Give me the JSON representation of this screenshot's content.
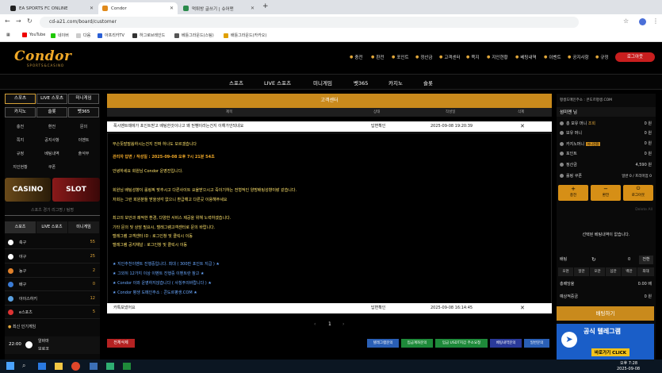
{
  "browser": {
    "tabs": [
      {
        "title": "EA SPORTS FC ONLINE",
        "active": false
      },
      {
        "title": "Condor",
        "active": true
      },
      {
        "title": "먹튀방 글쓰기 | 슈어맨",
        "active": false
      }
    ],
    "new_tab": "+",
    "url": "cd-a21.com/board/customer",
    "bookmarks": [
      "YouTube",
      "네이버",
      "다음",
      "아프리카TV",
      "하그로브레인드",
      "베틀그라운드(스팀)",
      "배틀그라운드(카카오)"
    ]
  },
  "site": {
    "logo": "Condor",
    "logo_sub": "SPORTS&CASINO",
    "top_nav": [
      "충전",
      "환전",
      "포인트",
      "정산금",
      "고객센터",
      "쪽지",
      "지인현황",
      "베팅내역",
      "이벤트",
      "공지사항",
      "규정"
    ],
    "logout": "로그아웃",
    "main_nav": [
      "스포츠",
      "LIVE 스포츠",
      "미니게임",
      "벳365",
      "카지노",
      "슬롯"
    ]
  },
  "left": {
    "grid": [
      [
        "스포츠",
        "LIVE 스포츠",
        "미니게임"
      ],
      [
        "카지노",
        "슬롯",
        "벳365"
      ]
    ],
    "menu": [
      [
        "충전",
        "환전",
        "문의"
      ],
      [
        "쪽지",
        "공지사항",
        "이벤트"
      ],
      [
        "규정",
        "베팅내역",
        "출석부"
      ],
      [
        "지인현황",
        "쿠폰",
        ""
      ]
    ],
    "banners": [
      "CASINO",
      "SLOT"
    ],
    "search_placeholder": "스포츠 경기 리그명 / 팀명",
    "sport_tabs": [
      "스포츠",
      "LIVE 스포츠",
      "미니게임"
    ],
    "sports": [
      {
        "name": "축구",
        "count": "55",
        "color": "#ffffff"
      },
      {
        "name": "야구",
        "count": "25",
        "color": "#ffffff"
      },
      {
        "name": "농구",
        "count": "2",
        "color": "#e0802a"
      },
      {
        "name": "배구",
        "count": "0",
        "color": "#3a7bd5"
      },
      {
        "name": "아이스하키",
        "count": "12",
        "color": "#5aa0e0"
      },
      {
        "name": "e스포츠",
        "count": "5",
        "color": "#d33"
      }
    ],
    "popular_title": "최신 인기게임",
    "match": {
      "time": "22:00",
      "team1": "알바마",
      "team2": "모로코"
    }
  },
  "center": {
    "title": "고객센터",
    "headers": [
      "제목",
      "상태",
      "작성일",
      "삭제"
    ],
    "rows": [
      {
        "title": "폭시벤트때에가 포인트받고 배팅한것이나고 왜 믿뺑이라는건지 이해가안되네요",
        "status": "답변확인",
        "date": "2025-09-08 19:20:39",
        "del": "✕"
      },
      {
        "title": "카톡보냈어요",
        "status": "답변확인",
        "date": "2025-09-08 16:14:45",
        "del": "✕"
      }
    ],
    "content": [
      {
        "text": "무슨뜻발말씀하시는건지 진짜 하나도 모르겠습니다",
        "color": "#ffe36b"
      },
      {
        "text": "관리자 답변 / 작성일 : 2025-09-08 오후 7시 21분 54초",
        "color": "#f0a928"
      },
      {
        "text": "안녕하세요 회원님 Condor 운영진입니다.",
        "color": "#ffe36b"
      },
      {
        "text": "회원님 배팅성향이 롤링픽 맞추시고 다른사이트 요율받으시고 죽이기하는 전형적인 양방배팅성향이랑 같습니다.",
        "color": "#ffe36b"
      },
      {
        "text": "저희는 그런 회원분들 받을생각 없으니 환급해고 다른곳 이용해주세요",
        "color": "#ffe36b"
      },
      {
        "text": "최고의 보안과 쾌적한 환경, 다양한 서비스 제공을 위해 노력하겠습니다.",
        "color": "#ffe36b"
      },
      {
        "text": "기타 문의 및 상담 필요시, 텔레그램고객센터로 문의 바랍니다.",
        "color": "#ffe36b"
      },
      {
        "text": "텔레그램 고객센터 ID : 로그인창 및 클릭시 이동",
        "color": "#ffe36b"
      },
      {
        "text": "텔레그램 공지채널 : 로그인창 및 클릭시 이동",
        "color": "#ffe36b"
      },
      {
        "text": "★ 지인추천이벤트 진행중입니다. 최대 ( 300만 포인트 지급 ) ★",
        "color": "#6aa8ff"
      },
      {
        "text": "★ 그외뒤 12가지 이상 이벤트 진행중 이벤트란 참고 ★",
        "color": "#6aa8ff"
      },
      {
        "text": "★ Condor 이와 운영하지않습니다 ( 사칭주의바랍니다 ) ★",
        "color": "#6aa8ff"
      },
      {
        "text": "★ Condor 평생 도메인주소 : 콘도르평생.COM ★",
        "color": "#6aa8ff"
      }
    ],
    "page": "1",
    "delete_all": "전체삭제",
    "bottom_buttons": [
      {
        "label": "텔레그램문의",
        "color": "#2a5fb5"
      },
      {
        "label": "입금계좌문의",
        "color": "#1e8a3a"
      },
      {
        "label": "입금 USDT지갑 주소요청",
        "color": "#1e8a3a"
      },
      {
        "label": "베팅내역문의",
        "color": "#2a3a9a"
      },
      {
        "label": "일반문의",
        "color": "#2a5fb5"
      }
    ]
  },
  "right": {
    "domain": "평생도메인주소 : 콘도르평생.COM",
    "user": "섬미멘 님",
    "rows": [
      {
        "label": "총 보유 머니",
        "badge": "조회",
        "value": "0 원"
      },
      {
        "label": "보유 머니",
        "badge": "",
        "value": "0 원"
      },
      {
        "label": "카지노머니",
        "badge": "머니전환",
        "value": "0 원"
      },
      {
        "label": "포인트",
        "badge": "",
        "value": "0 원"
      },
      {
        "label": "정산금",
        "badge": "",
        "value": "4,590 원"
      },
      {
        "label": "롤링 쿠폰",
        "badge": "",
        "value": "일반 0 / 프리미엄 0"
      }
    ],
    "actions": [
      "충전",
      "환전",
      "로그아웃"
    ],
    "delete_all": "Delete All",
    "bet_empty": "선택된 베팅내역이 없습니다.",
    "bet_label": "배팅",
    "bet_value": "0",
    "bet_reset": "전환",
    "bet_chips": [
      "오천",
      "일만",
      "오만",
      "십만",
      "백만",
      "최대"
    ],
    "odds_label": "총배당율",
    "odds_value": "0.00 배",
    "win_label": "예상적중금",
    "win_value": "0 원",
    "bet_button": "배팅하기",
    "tg_title": "공식 텔레그램",
    "tg_cta": "바로가기 CLICK"
  },
  "taskbar": {
    "time": "오후 7:28",
    "date": "2025-09-08"
  },
  "colors": {
    "accent": "#c98a1c",
    "logout": "#c81e1e",
    "background": "#000000"
  }
}
